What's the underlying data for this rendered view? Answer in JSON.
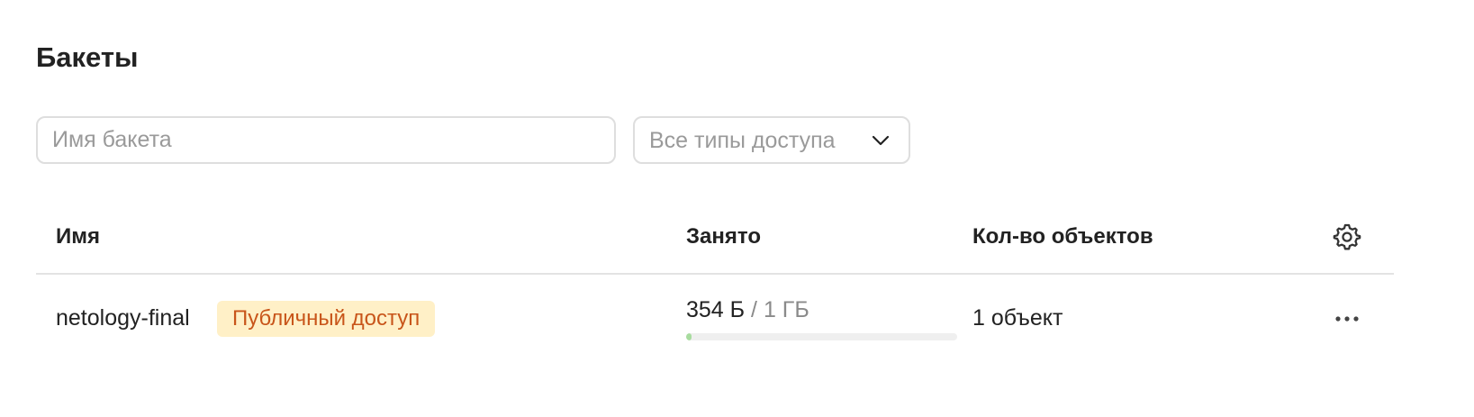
{
  "page": {
    "title": "Бакеты"
  },
  "filters": {
    "search_placeholder": "Имя бакета",
    "search_value": "",
    "access_type_selected": "Все типы доступа"
  },
  "table": {
    "columns": {
      "name": "Имя",
      "used": "Занято",
      "objects": "Кол-во объектов"
    },
    "rows": [
      {
        "name": "netology-final",
        "access_badge": "Публичный доступ",
        "used": "354 Б",
        "separator": "/",
        "quota": "1 ГБ",
        "usage_fraction": 3e-07,
        "objects": "1 объект"
      }
    ]
  },
  "icons": {
    "settings": "gear-icon",
    "dropdown": "chevron-down-icon",
    "more": "more-horizontal-icon"
  },
  "colors": {
    "badge_background": "#fff0c7",
    "badge_text": "#c8551a",
    "progress_fill": "#a8dc9f",
    "border": "#dedede"
  }
}
